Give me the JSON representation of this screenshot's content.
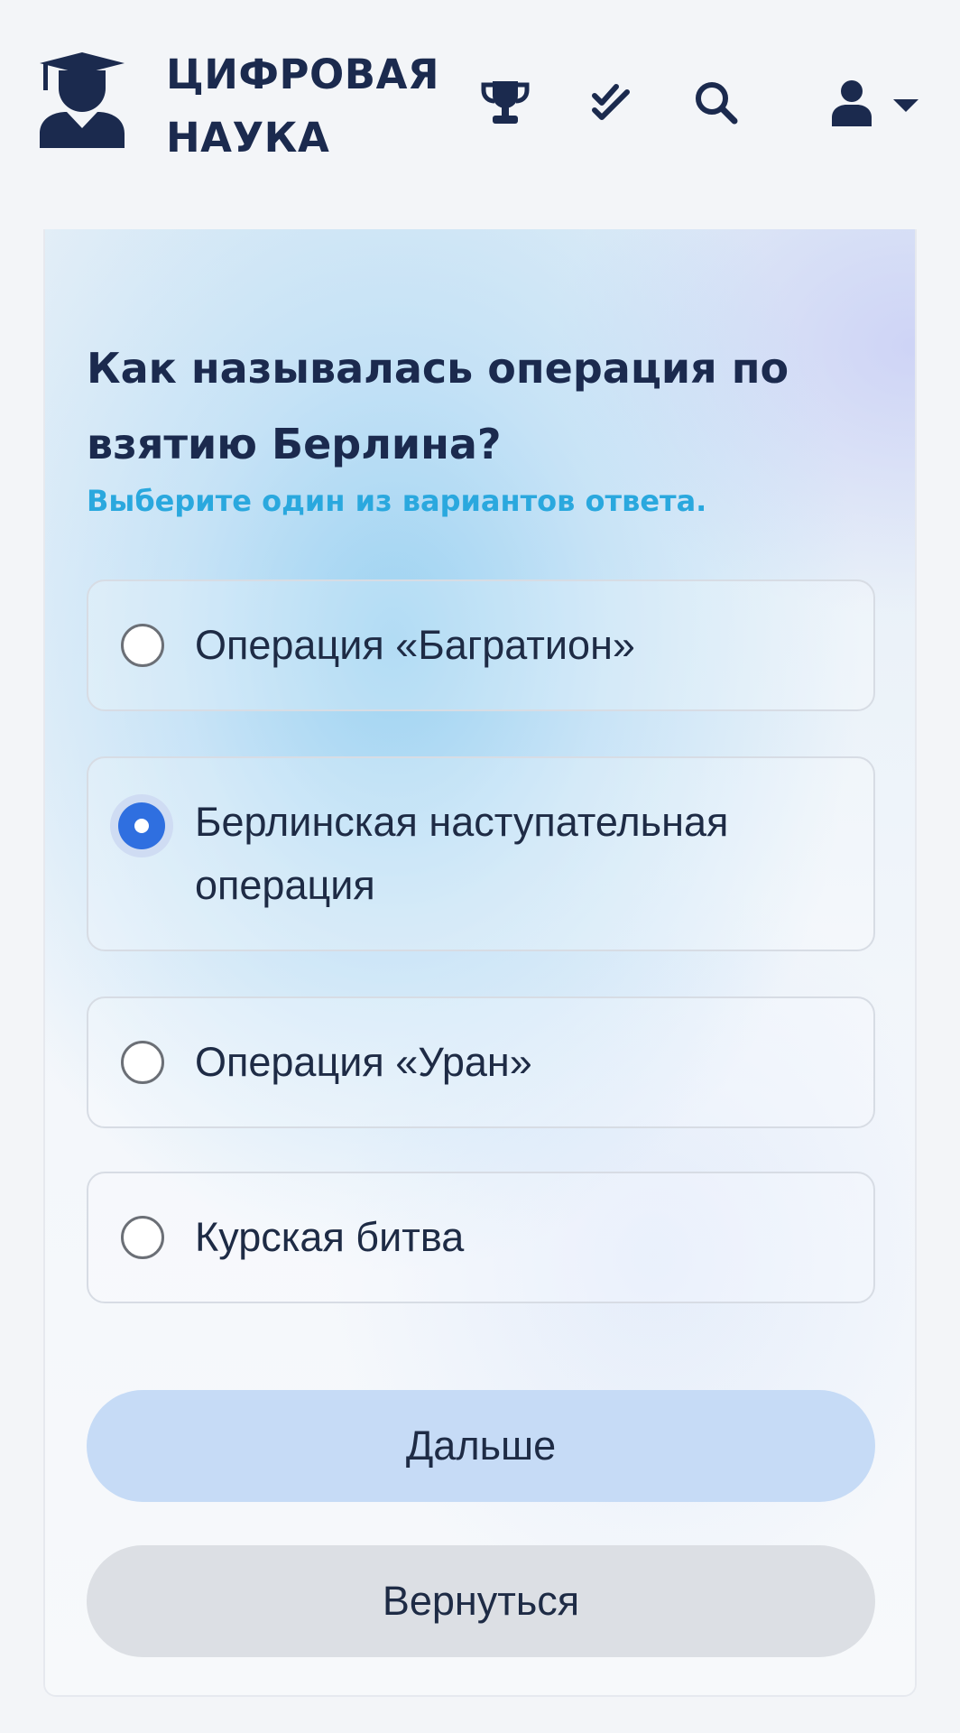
{
  "header": {
    "brand_line1": "ЦИФРОВАЯ",
    "brand_line2": "НАУКА",
    "logo_icon": "graduate-cap-user-icon",
    "nav_icons": [
      "trophy-icon",
      "double-check-icon",
      "search-icon",
      "user-icon",
      "caret-down-icon"
    ]
  },
  "quiz": {
    "question": "Как называлась операция по взятию Берлина?",
    "hint": "Выберите один из вариантов ответа.",
    "options": [
      {
        "label": "Операция «Багратион»",
        "selected": false
      },
      {
        "label": "Берлинская наступательная операция",
        "selected": true
      },
      {
        "label": "Операция «Уран»",
        "selected": false
      },
      {
        "label": "Курская битва",
        "selected": false
      }
    ]
  },
  "buttons": {
    "next_label": "Дальше",
    "back_label": "Вернуться"
  },
  "colors": {
    "brand_text": "#1b2a4e",
    "hint": "#2aa8de",
    "radio_selected": "#2f6fe0",
    "next_button": "#c6dbf6",
    "back_button": "#dcdfe4"
  }
}
